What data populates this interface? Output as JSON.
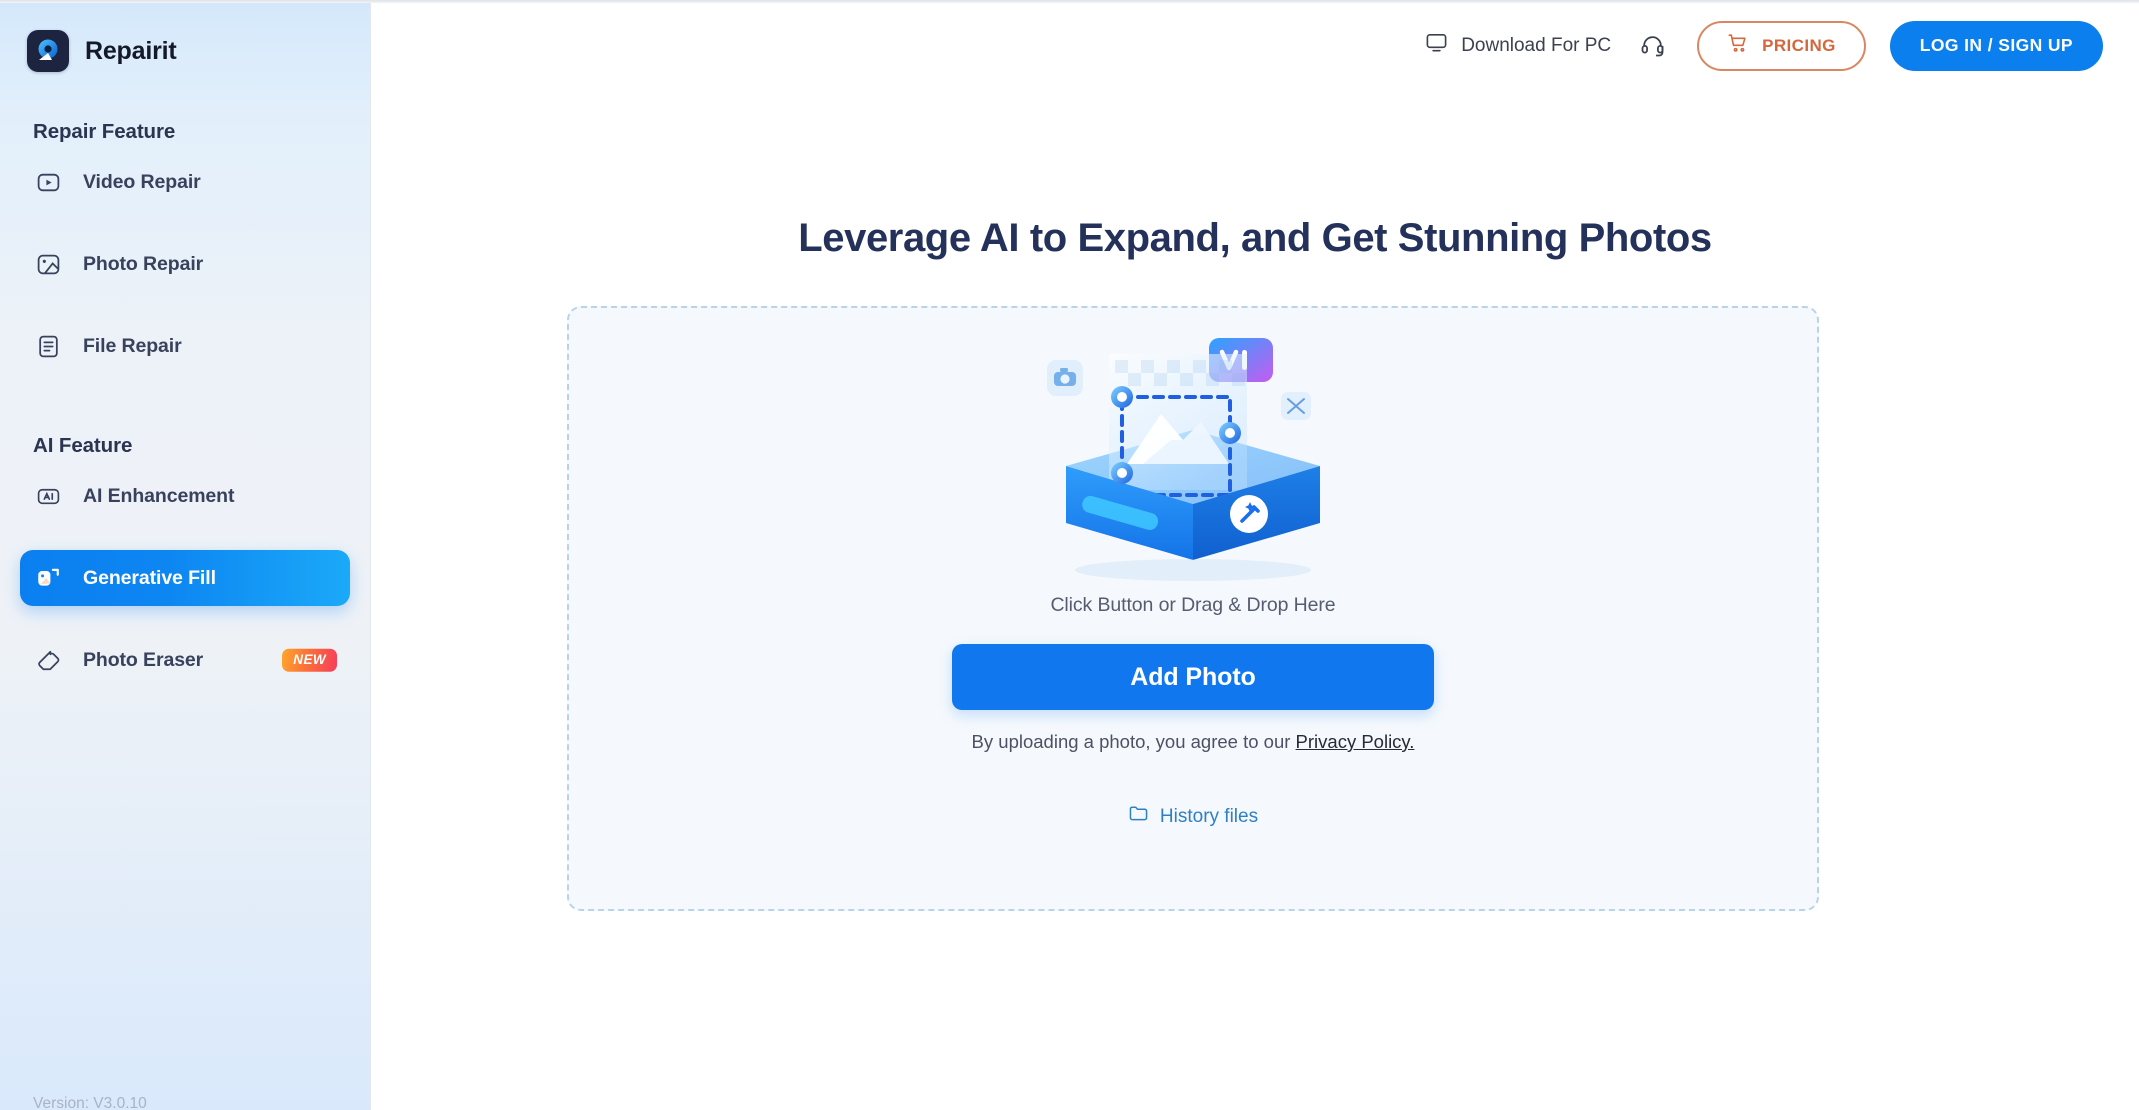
{
  "app": {
    "brand_name": "Repairit",
    "logo_icon": "repairit-logo-icon",
    "version": "Version: V3.0.10"
  },
  "sidebar": {
    "sections": [
      {
        "title": "Repair Feature",
        "items": [
          {
            "label": "Video Repair",
            "icon": "video-repair-icon",
            "active": false,
            "badge": null
          },
          {
            "label": "Photo Repair",
            "icon": "photo-repair-icon",
            "active": false,
            "badge": null
          },
          {
            "label": "File Repair",
            "icon": "file-repair-icon",
            "active": false,
            "badge": null
          }
        ]
      },
      {
        "title": "AI Feature",
        "items": [
          {
            "label": "AI Enhancement",
            "icon": "ai-enhancement-icon",
            "active": false,
            "badge": null
          },
          {
            "label": "Generative Fill",
            "icon": "generative-fill-icon",
            "active": true,
            "badge": null
          },
          {
            "label": "Photo Eraser",
            "icon": "photo-eraser-icon",
            "active": false,
            "badge": "NEW"
          }
        ]
      }
    ]
  },
  "header": {
    "download_label": "Download For PC",
    "download_icon": "monitor-icon",
    "support_icon": "headset-icon",
    "pricing_label": "PRICING",
    "pricing_icon": "shopping-cart-icon",
    "login_label": "LOG IN / SIGN UP"
  },
  "main": {
    "title": "Leverage AI to Expand, and Get Stunning Photos",
    "dropzone": {
      "illustration_icon": "ai-photo-expand-illustration",
      "hint": "Click Button or Drag & Drop Here",
      "add_photo_label": "Add Photo",
      "privacy_prefix": "By uploading a photo, you agree to our ",
      "privacy_link": "Privacy Policy.",
      "history_label": "History files",
      "history_icon": "folder-icon"
    }
  },
  "colors": {
    "accent_blue": "#1077ef",
    "active_gradient_start": "#0b7ff0",
    "active_gradient_end": "#1ba9f8",
    "pricing_orange": "#d4673b",
    "badge_gradient_start": "#ffa62b",
    "badge_gradient_end": "#f53d5c",
    "title_navy": "#24325b",
    "dropzone_border": "#b9d4ea",
    "dropzone_fill": "#f5f9fd",
    "history_link": "#2f7fc4"
  }
}
